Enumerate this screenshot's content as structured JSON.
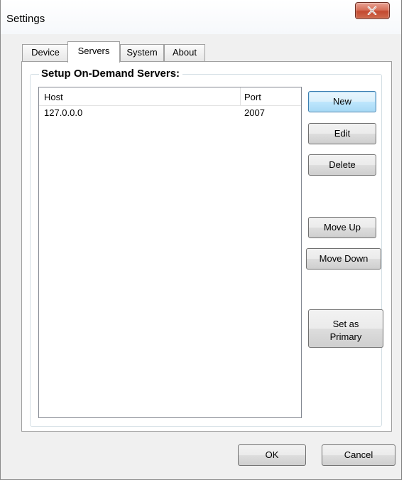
{
  "window": {
    "title": "Settings"
  },
  "tabs": [
    {
      "label": "Device"
    },
    {
      "label": "Servers"
    },
    {
      "label": "System"
    },
    {
      "label": "About"
    }
  ],
  "group": {
    "title": "Setup On-Demand Servers:"
  },
  "list": {
    "columns": [
      "Host",
      "Port"
    ],
    "rows": [
      {
        "host": "127.0.0.0",
        "port": "2007"
      }
    ]
  },
  "side_buttons": {
    "new": "New",
    "edit": "Edit",
    "delete": "Delete",
    "move_up": "Move Up",
    "move_down": "Move Down",
    "set_primary_line1": "Set as",
    "set_primary_line2": "Primary"
  },
  "footer": {
    "ok": "OK",
    "cancel": "Cancel"
  },
  "colors": {
    "close_button": "#c94f36",
    "default_button_border": "#3c7fb1"
  }
}
